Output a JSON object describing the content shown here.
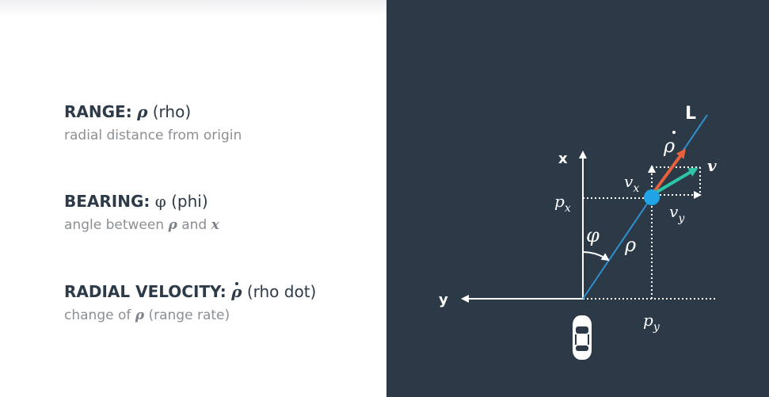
{
  "definitions": {
    "range": {
      "label": "RANGE:",
      "symbol": "ρ",
      "name": "(rho)",
      "description": "radial distance from origin"
    },
    "bearing": {
      "label": "BEARING:",
      "symbol": "φ",
      "name": "(phi)",
      "desc_prefix": "angle between",
      "desc_sym1": "ρ",
      "desc_and": "and",
      "desc_sym2": "x"
    },
    "radial_velocity": {
      "label": "RADIAL VELOCITY:",
      "symbol": "ρ",
      "name": "(rho dot)",
      "desc_prefix": "change of",
      "desc_sym": "ρ",
      "desc_suffix": "(range rate)"
    }
  },
  "diagram": {
    "axis_x_label": "x",
    "axis_y_label": "y",
    "line_label": "L",
    "rho_label": "ρ",
    "rho_dot_label": "ρ",
    "phi_label": "φ",
    "v_label": "v",
    "vx_label": "vx",
    "vy_label": "vy",
    "px_label": "px",
    "py_label": "py",
    "colors": {
      "background": "#2c3a48",
      "line": "#2f8fcf",
      "point": "#20a6e8",
      "rho_dot_arrow": "#e8603c",
      "v_arrow": "#2ec4a6",
      "axes": "#ffffff"
    },
    "icons": {
      "vehicle": "car-top-view-icon"
    }
  }
}
